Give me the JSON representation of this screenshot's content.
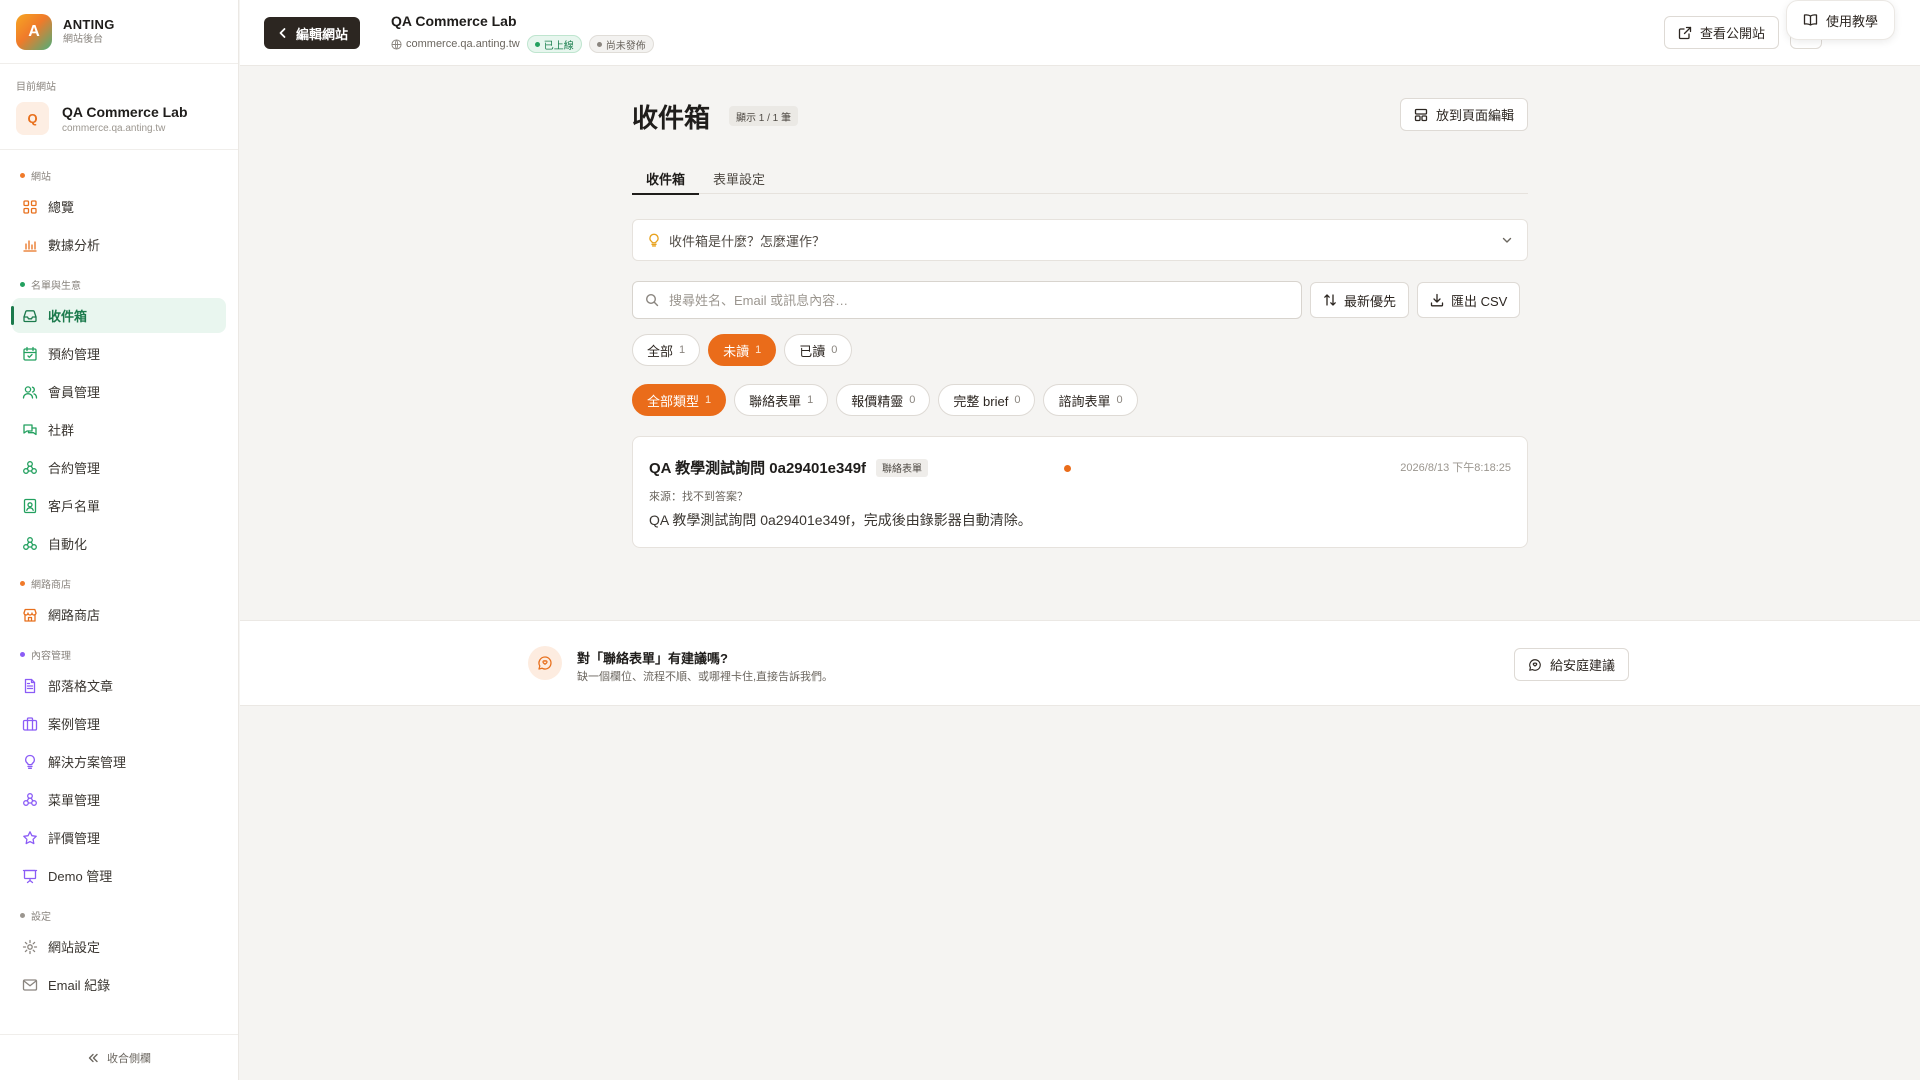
{
  "brand": {
    "logo_letter": "A",
    "name": "ANTING",
    "subtitle": "網站後台"
  },
  "current_site": {
    "caption": "目前網站",
    "avatar_letter": "Q",
    "name": "QA Commerce Lab",
    "domain": "commerce.qa.anting.tw"
  },
  "sidebar": {
    "sections": [
      {
        "label": "網站",
        "dot_color": "#f07a2a",
        "items": [
          {
            "label": "總覽",
            "icon": "grid-icon",
            "color": "#e8701d"
          },
          {
            "label": "數據分析",
            "icon": "bar-chart-icon",
            "color": "#e8701d"
          }
        ]
      },
      {
        "label": "名單與生意",
        "dot_color": "#23a05f",
        "items": [
          {
            "label": "收件箱",
            "icon": "inbox-icon",
            "color": "#1b7a4c",
            "active": true
          },
          {
            "label": "預約管理",
            "icon": "calendar-icon",
            "color": "#23a05f"
          },
          {
            "label": "會員管理",
            "icon": "users-icon",
            "color": "#23a05f"
          },
          {
            "label": "社群",
            "icon": "chat-icon",
            "color": "#23a05f"
          },
          {
            "label": "合約管理",
            "icon": "nodes-icon",
            "color": "#23a05f"
          },
          {
            "label": "客戶名單",
            "icon": "contact-icon",
            "color": "#23a05f"
          },
          {
            "label": "自動化",
            "icon": "nodes-icon",
            "color": "#23a05f"
          }
        ]
      },
      {
        "label": "網路商店",
        "dot_color": "#f07a2a",
        "items": [
          {
            "label": "網路商店",
            "icon": "store-icon",
            "color": "#e8701d"
          }
        ]
      },
      {
        "label": "內容管理",
        "dot_color": "#8b5cf6",
        "items": [
          {
            "label": "部落格文章",
            "icon": "document-icon",
            "color": "#8b5cf6"
          },
          {
            "label": "案例管理",
            "icon": "briefcase-icon",
            "color": "#8b5cf6"
          },
          {
            "label": "解決方案管理",
            "icon": "bulb-icon",
            "color": "#8b5cf6"
          },
          {
            "label": "菜單管理",
            "icon": "nodes-icon",
            "color": "#8b5cf6"
          },
          {
            "label": "評價管理",
            "icon": "star-icon",
            "color": "#8b5cf6"
          },
          {
            "label": "Demo 管理",
            "icon": "presentation-icon",
            "color": "#8b5cf6"
          }
        ]
      },
      {
        "label": "設定",
        "dot_color": "#9b968f",
        "items": [
          {
            "label": "網站設定",
            "icon": "gear-icon",
            "color": "#8a857f"
          },
          {
            "label": "Email 紀錄",
            "icon": "mail-icon",
            "color": "#8a857f"
          }
        ]
      }
    ],
    "collapse_label": "收合側欄"
  },
  "topbar": {
    "back_label": "編輯網站",
    "site_title": "QA Commerce Lab",
    "site_domain": "commerce.qa.anting.tw",
    "status_live": "已上線",
    "status_draft": "尚未發佈",
    "view_site_label": "查看公開站",
    "tutorial_label": "使用教學"
  },
  "page": {
    "title": "收件箱",
    "count_badge": "顯示 1 / 1 筆",
    "edit_button": "放到頁面編輯",
    "tabs": [
      "收件箱",
      "表單設定"
    ],
    "faq_text": "收件箱是什麼？怎麼運作？",
    "search_placeholder": "搜尋姓名、Email 或訊息內容…",
    "sort_label": "最新優先",
    "export_label": "匯出 CSV",
    "status_filters": [
      {
        "label": "全部",
        "count": "1",
        "on": false
      },
      {
        "label": "未讀",
        "count": "1",
        "on": true
      },
      {
        "label": "已讀",
        "count": "0",
        "on": false
      }
    ],
    "type_filters": [
      {
        "label": "全部類型",
        "count": "1",
        "on": true
      },
      {
        "label": "聯絡表單",
        "count": "1",
        "on": false
      },
      {
        "label": "報價精靈",
        "count": "0",
        "on": false
      },
      {
        "label": "完整 brief",
        "count": "0",
        "on": false
      },
      {
        "label": "諮詢表單",
        "count": "0",
        "on": false
      }
    ],
    "message": {
      "title": "QA 教學測試詢問 0a29401e349f",
      "tag": "聯絡表單",
      "time": "2026/8/13 下午8:18:25",
      "source": "來源：找不到答案？",
      "body": "QA 教學測試詢問 0a29401e349f，完成後由錄影器自動清除。"
    }
  },
  "feedback": {
    "title": "對「聯絡表單」有建議嗎?",
    "subtitle": "缺一個欄位、流程不順、或哪裡卡住,直接告訴我們。",
    "button": "給安庭建議"
  },
  "colors": {
    "accent_orange": "#ea6c1a",
    "accent_green": "#1b7a4c",
    "dark_button": "#2c2621"
  }
}
